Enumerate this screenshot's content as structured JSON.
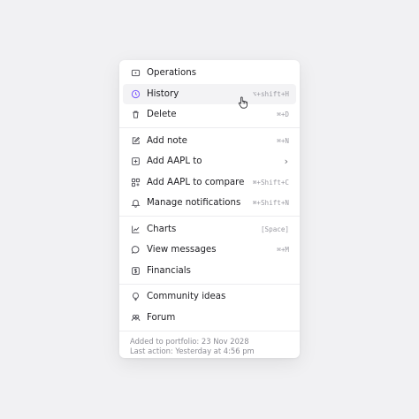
{
  "menu": {
    "groups": [
      [
        {
          "label": "Operations",
          "icon": "tag-icon",
          "shortcut": ""
        },
        {
          "label": "History",
          "icon": "history-icon",
          "shortcut": "⌥+shift+H",
          "highlighted": true
        },
        {
          "label": "Delete",
          "icon": "trash-icon",
          "shortcut": "⌘+D"
        }
      ],
      [
        {
          "label": "Add note",
          "icon": "edit-icon",
          "shortcut": "⌘+N"
        },
        {
          "label": "Add AAPL to",
          "icon": "plus-square-icon",
          "shortcut": "›"
        },
        {
          "label": "Add AAPL to compare",
          "icon": "compare-icon",
          "shortcut": "⌘+Shift+C"
        },
        {
          "label": "Manage notifications",
          "icon": "bell-icon",
          "shortcut": "⌘+Shift+N"
        }
      ],
      [
        {
          "label": "Charts",
          "icon": "chart-icon",
          "shortcut": "[Space]"
        },
        {
          "label": "View messages",
          "icon": "message-icon",
          "shortcut": "⌘+M"
        },
        {
          "label": "Financials",
          "icon": "dollar-icon",
          "shortcut": ""
        }
      ],
      [
        {
          "label": "Community ideas",
          "icon": "lightbulb-icon",
          "shortcut": ""
        },
        {
          "label": "Forum",
          "icon": "users-icon",
          "shortcut": ""
        }
      ]
    ],
    "footer": {
      "line1": "Added to portfolio: 23 Nov 2028",
      "line2": "Last action: Yesterday at 4:56 pm"
    }
  },
  "colors": {
    "accent": "#7c5cff",
    "highlight_bg": "#f3f3f5"
  }
}
